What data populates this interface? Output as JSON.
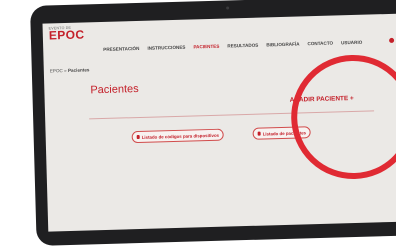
{
  "logo": {
    "small_text": "EVENTO DE",
    "main_text": "EPOC"
  },
  "nav": {
    "items": [
      {
        "label": "PRESENTACIÓN"
      },
      {
        "label": "INSTRUCCIONES"
      },
      {
        "label": "PACIENTES",
        "active": true
      },
      {
        "label": "RESULTADOS"
      },
      {
        "label": "BIBLIOGRAFÍA"
      },
      {
        "label": "CONTACTO"
      },
      {
        "label": "USUARIO"
      }
    ]
  },
  "breadcrumb": {
    "home": "EPOC",
    "separator": " » ",
    "current": "Pacientes"
  },
  "page": {
    "title": "Pacientes",
    "add_button": "AÑADIR PACIENTE +",
    "download_buttons": [
      {
        "label": "Listado de códigos para dispositivos"
      },
      {
        "label": "Listado de pacientes"
      }
    ]
  },
  "colors": {
    "accent": "#c4202a",
    "highlight_circle": "#e02a33",
    "background": "#ebe9e6",
    "bezel": "#1f1f21"
  }
}
